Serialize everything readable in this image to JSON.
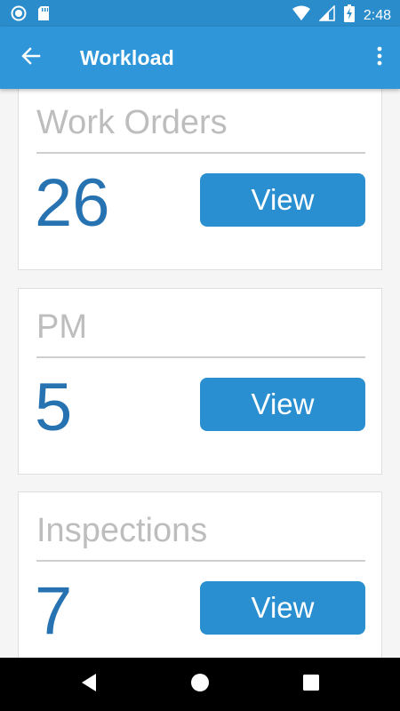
{
  "status_bar": {
    "time": "2:48",
    "icons": [
      "sync-icon",
      "sd-card-icon",
      "wifi-icon",
      "signal-icon",
      "battery-charging-icon"
    ]
  },
  "app_bar": {
    "title": "Workload",
    "back_icon": "arrow-left-icon",
    "menu_icon": "more-vert-icon"
  },
  "cards": [
    {
      "title": "Work Orders",
      "count": "26",
      "button_label": "View"
    },
    {
      "title": "PM",
      "count": "5",
      "button_label": "View"
    },
    {
      "title": "Inspections",
      "count": "7",
      "button_label": "View"
    }
  ],
  "nav_bar": {
    "icons": [
      "back-triangle-icon",
      "home-circle-icon",
      "recents-square-icon"
    ]
  },
  "colors": {
    "status_bar": "#2a8ccb",
    "app_bar": "#2f97d9",
    "count_text": "#2773b2",
    "button": "#2a8fd0",
    "title_text": "#bdbdbd"
  }
}
